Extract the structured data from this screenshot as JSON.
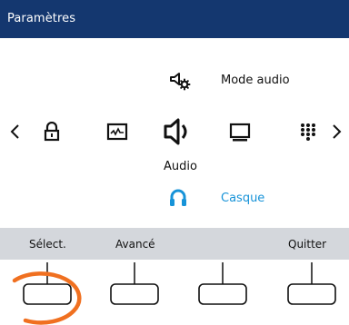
{
  "header": {
    "title": "Paramètres"
  },
  "submenu": {
    "mode_label": "Mode audio",
    "mode_icon": "speaker-gear-icon",
    "casque_label": "Casque",
    "casque_icon": "headset-icon"
  },
  "carousel": {
    "selected_label": "Audio",
    "items": [
      "lock-icon",
      "picture-icon",
      "speaker-icon",
      "monitor-icon",
      "keypad-icon"
    ],
    "prev": "chevron-left-icon",
    "next": "chevron-right-icon"
  },
  "softkeys": {
    "key1_label": "Sélect.",
    "key2_label": "Avancé",
    "key3_label": "",
    "key4_label": "Quitter"
  },
  "colors": {
    "header_bg": "#14376f",
    "accent": "#1793d8",
    "softbar_bg": "#d4d7dc",
    "highlight": "#f07020"
  }
}
